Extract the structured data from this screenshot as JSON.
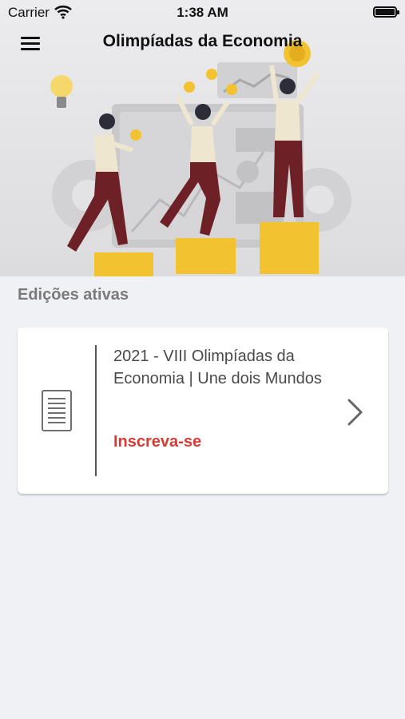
{
  "status_bar": {
    "carrier": "Carrier",
    "time": "1:38 AM"
  },
  "header": {
    "title": "Olimpíadas da Economia",
    "menu_icon": "hamburger-menu-icon"
  },
  "hero": {
    "illustration": "team-celebrating-on-podium-with-coins-and-charts"
  },
  "main": {
    "section_title": "Edições ativas",
    "editions": [
      {
        "title": "2021 - VIII Olimpíadas da Economia | Une dois Mundos",
        "action": "Inscreva-se",
        "icon": "document-icon",
        "chevron_icon": "chevron-right-icon"
      }
    ]
  },
  "colors": {
    "accent": "#d93a32",
    "background": "#f0f1f4",
    "card": "#ffffff",
    "podium": "#f2c230"
  }
}
